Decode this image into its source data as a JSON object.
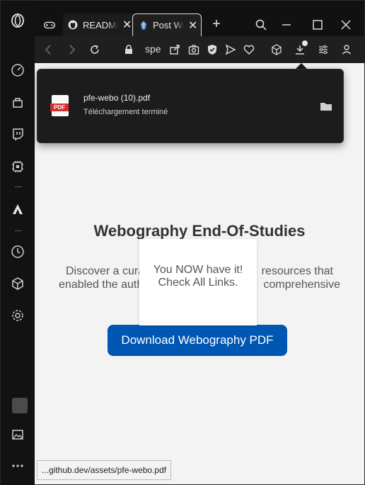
{
  "tabs": [
    {
      "label": "README",
      "icon": "github-icon"
    },
    {
      "label": "Post Web",
      "icon": "site-favicon",
      "active": true
    }
  ],
  "toolbar": {
    "url_fragment": "spe"
  },
  "download": {
    "file_name": "pfe-webo (10).pdf",
    "status": "Téléchargement terminé",
    "badge": "PDF"
  },
  "page": {
    "heading": "Webography End-Of-Studies",
    "description_line1": "Discover a cura",
    "description_line1_end": "resources that",
    "description_line2": "enabled the auth",
    "description_line2_end": "comprehensive",
    "button_label": "Download Webography PDF",
    "modal_line1": "You NOW have it!",
    "modal_line2": "Check All Links."
  },
  "status_bar": {
    "link_url": "...github.dev/assets/pfe-webo.pdf"
  },
  "colors": {
    "primary_button": "#0056b3",
    "pdf_badge": "#d32f2f"
  }
}
